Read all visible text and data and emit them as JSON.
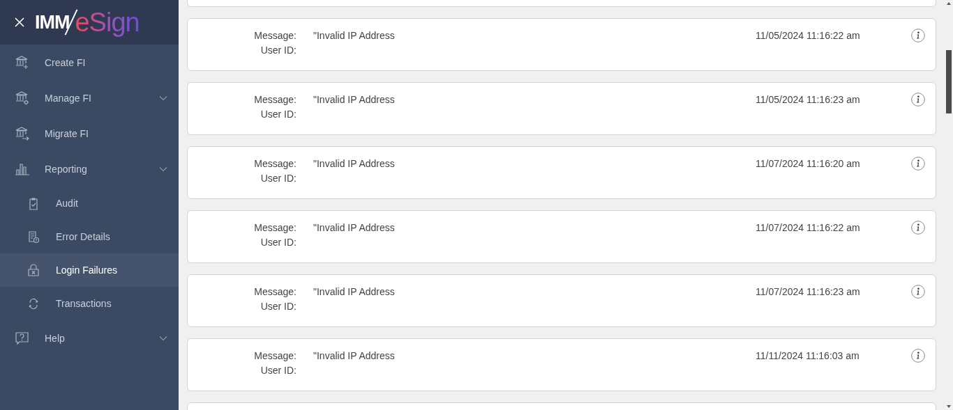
{
  "sidebar": {
    "logo": {
      "prefix": "IMM",
      "brand": "eSign"
    },
    "items": [
      {
        "label": "Create FI",
        "expandable": false,
        "selected": false
      },
      {
        "label": "Manage FI",
        "expandable": true,
        "selected": false
      },
      {
        "label": "Migrate FI",
        "expandable": false,
        "selected": false
      },
      {
        "label": "Reporting",
        "expandable": true,
        "selected": false,
        "children": [
          {
            "label": "Audit",
            "selected": false
          },
          {
            "label": "Error Details",
            "selected": false
          },
          {
            "label": "Login Failures",
            "selected": true
          },
          {
            "label": "Transactions",
            "selected": false
          }
        ]
      },
      {
        "label": "Help",
        "expandable": true,
        "selected": false
      }
    ]
  },
  "entries": [
    {
      "message_label": "Message:",
      "message": "\"Invalid IP Address",
      "user_label": "User ID:",
      "time": "11/05/2024 11:16:22 am"
    },
    {
      "message_label": "Message:",
      "message": "\"Invalid IP Address",
      "user_label": "User ID:",
      "time": "11/05/2024 11:16:23 am"
    },
    {
      "message_label": "Message:",
      "message": "\"Invalid IP Address",
      "user_label": "User ID:",
      "time": "11/07/2024 11:16:20 am"
    },
    {
      "message_label": "Message:",
      "message": "\"Invalid IP Address",
      "user_label": "User ID:",
      "time": "11/07/2024 11:16:22 am"
    },
    {
      "message_label": "Message:",
      "message": "\"Invalid IP Address",
      "user_label": "User ID:",
      "time": "11/07/2024 11:16:23 am"
    },
    {
      "message_label": "Message:",
      "message": "\"Invalid IP Address",
      "user_label": "User ID:",
      "time": "11/11/2024 11:16:03 am"
    }
  ]
}
